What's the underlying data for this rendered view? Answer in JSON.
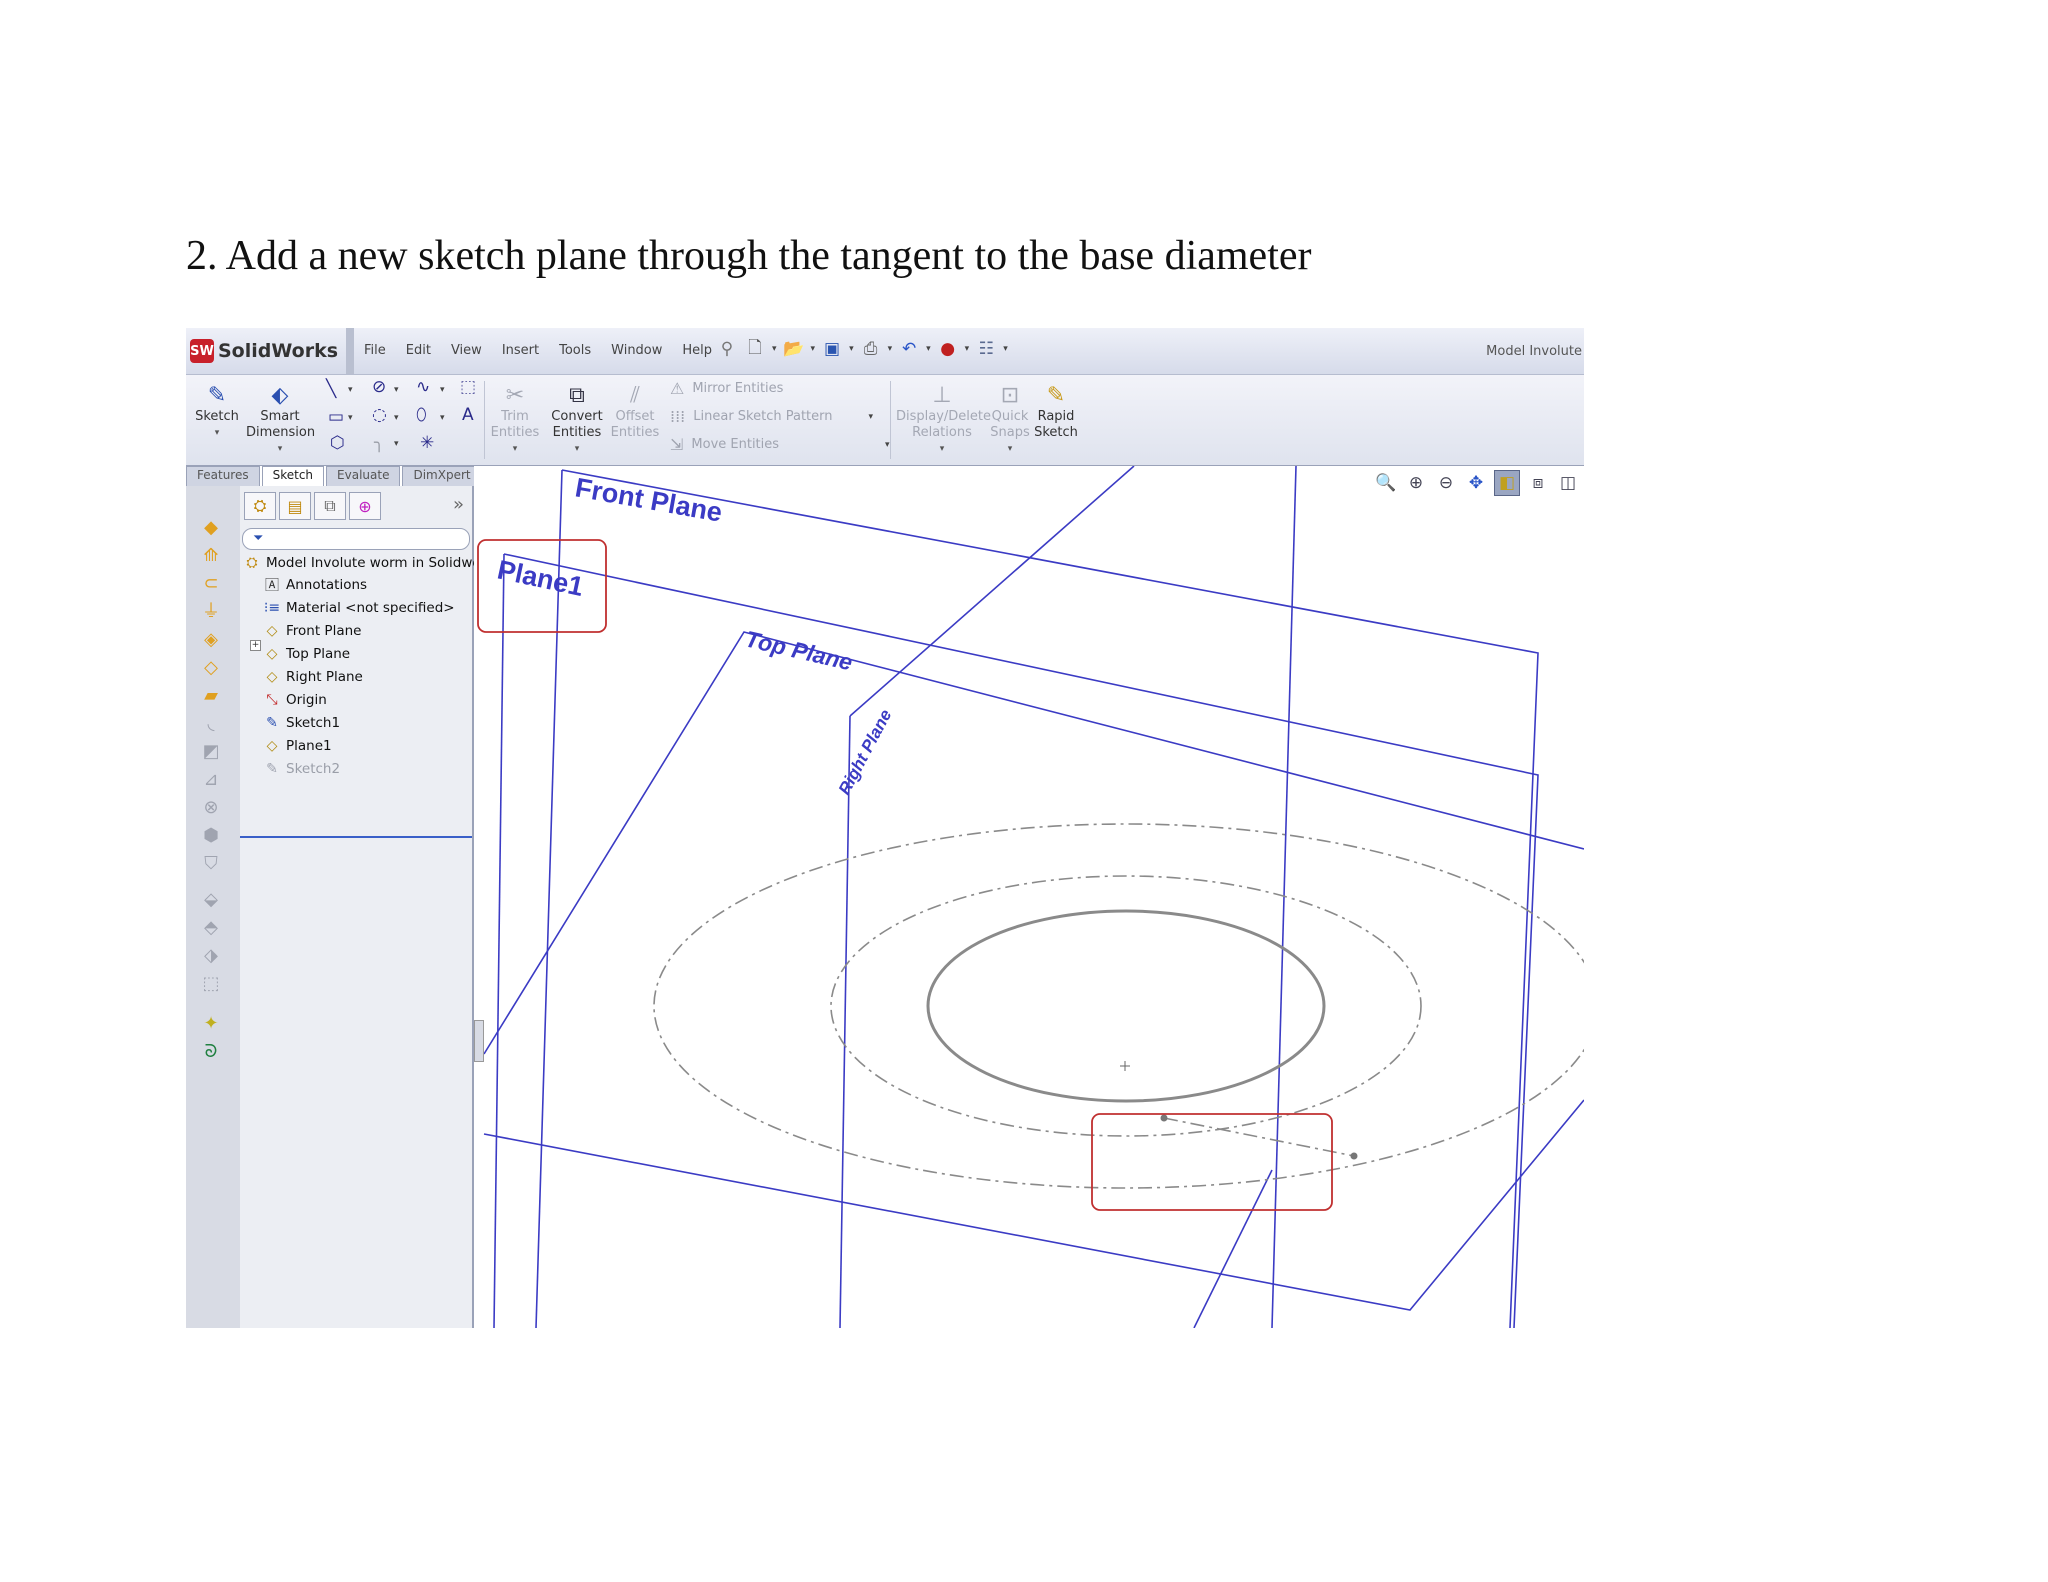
{
  "document": {
    "step_text": "2. Add a new sketch plane through the tangent to the base diameter"
  },
  "app": {
    "logo_badge": "SW",
    "logo_text": "SolidWorks",
    "menu": [
      "File",
      "Edit",
      "View",
      "Insert",
      "Tools",
      "Window",
      "Help"
    ],
    "doc_title": "Model Involute"
  },
  "quick_access": [
    "pin-icon",
    "new-document-icon",
    "open-folder-icon",
    "save-icon",
    "print-icon",
    "undo-icon",
    "traffic-light-icon",
    "options-icon"
  ],
  "command_manager": {
    "sketch": {
      "line1": "Sketch",
      "line2": ""
    },
    "smart_dimension": {
      "line1": "Smart",
      "line2": "Dimension"
    },
    "trim": {
      "line1": "Trim",
      "line2": "Entities"
    },
    "convert": {
      "line1": "Convert",
      "line2": "Entities"
    },
    "offset": {
      "line1": "Offset",
      "line2": "Entities"
    },
    "mirror": "Mirror Entities",
    "linear_pattern": "Linear Sketch Pattern",
    "move": "Move Entities",
    "display_delete": {
      "line1": "Display/Delete",
      "line2": "Relations"
    },
    "quick_snaps": {
      "line1": "Quick",
      "line2": "Snaps"
    },
    "rapid_sketch": {
      "line1": "Rapid",
      "line2": "Sketch"
    }
  },
  "tabs": [
    "Features",
    "Sketch",
    "Evaluate",
    "DimXpert"
  ],
  "active_tab": "Sketch",
  "feature_tree": {
    "root": "Model Involute worm in Solidworks",
    "items": [
      "Annotations",
      "Material <not specified>",
      "Front Plane",
      "Top Plane",
      "Right Plane",
      "Origin",
      "Sketch1",
      "Plane1",
      "Sketch2"
    ]
  },
  "viewport_labels": {
    "front_plane": "Front Plane",
    "plane1": "Plane1",
    "top_plane": "Top Plane",
    "right_plane": "Right Plane"
  },
  "colors": {
    "plane_lines": "#3b3bc4",
    "highlight_box": "#c03030",
    "sketch_gray": "#8a8a8a"
  }
}
